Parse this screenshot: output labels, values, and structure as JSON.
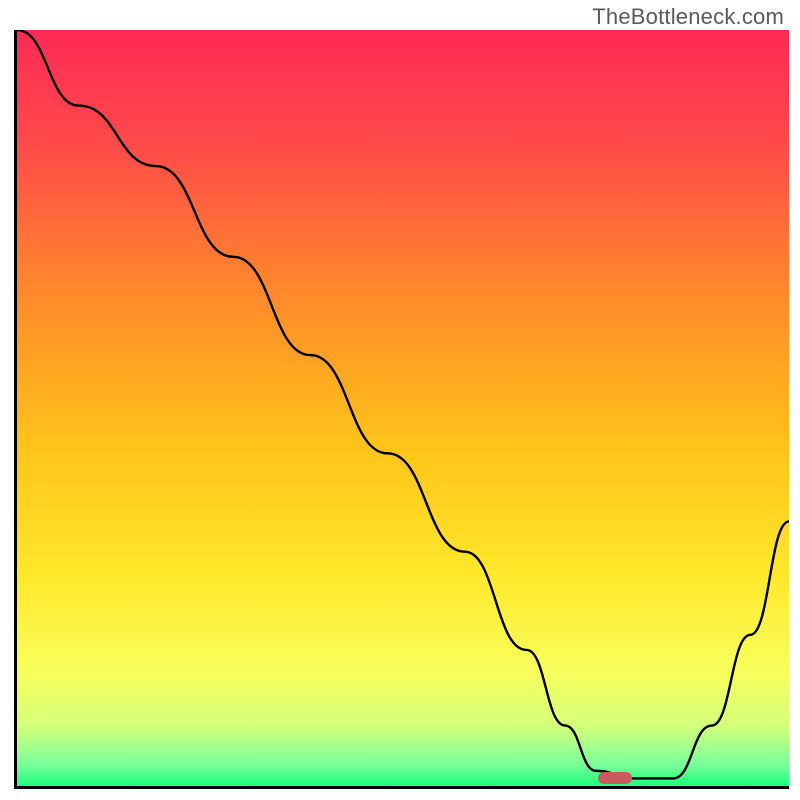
{
  "watermark": "TheBottleneck.com",
  "chart_data": {
    "type": "line",
    "title": "",
    "xlabel": "",
    "ylabel": "",
    "xlim": [
      0,
      100
    ],
    "ylim": [
      0,
      100
    ],
    "x": [
      0,
      8,
      18,
      28,
      38,
      48,
      58,
      66,
      71,
      75,
      80,
      85,
      90,
      95,
      100
    ],
    "y": [
      100,
      90,
      82,
      70,
      57,
      44,
      31,
      18,
      8,
      2,
      1,
      1,
      8,
      20,
      35
    ],
    "marker": {
      "x": 77.5,
      "y": 1
    },
    "gradient_stops": [
      {
        "offset": 0.0,
        "color": "#ff2a55"
      },
      {
        "offset": 0.15,
        "color": "#ff4a4a"
      },
      {
        "offset": 0.35,
        "color": "#ff8a2a"
      },
      {
        "offset": 0.55,
        "color": "#ffc31a"
      },
      {
        "offset": 0.72,
        "color": "#ffe82a"
      },
      {
        "offset": 0.85,
        "color": "#f7ff5c"
      },
      {
        "offset": 0.92,
        "color": "#d4ff7a"
      },
      {
        "offset": 0.97,
        "color": "#7dff9a"
      },
      {
        "offset": 1.0,
        "color": "#1dff7a"
      }
    ]
  }
}
